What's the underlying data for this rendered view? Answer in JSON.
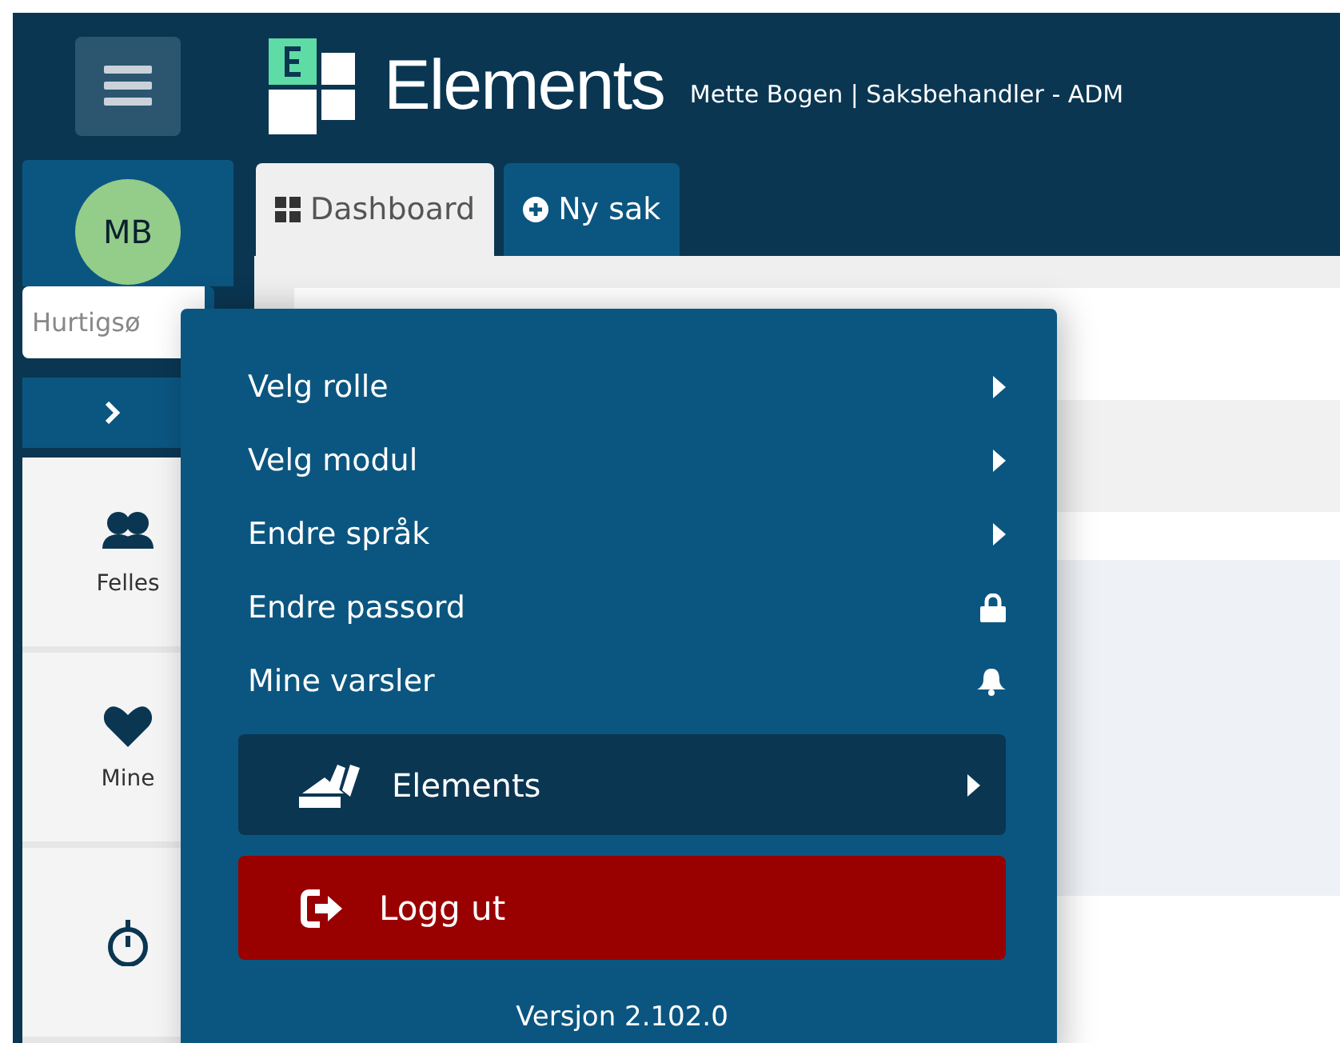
{
  "header": {
    "app_name": "Elements",
    "user": "Mette Bogen | Saksbehandler - ADM"
  },
  "sidebar": {
    "avatar": "MB",
    "search": {
      "placeholder": "Hurtigsø"
    },
    "nav": [
      {
        "label": "Felles",
        "kind": "people"
      },
      {
        "label": "Mine",
        "kind": "heart"
      },
      {
        "kind": "stopwatch"
      }
    ]
  },
  "tabs": [
    {
      "label": "Dashboard",
      "selected": true
    },
    {
      "label": "Ny sak",
      "selected": false
    }
  ],
  "user_menu": {
    "items": [
      {
        "label": "Velg rolle",
        "kind": "submenu"
      },
      {
        "label": "Velg modul",
        "kind": "submenu"
      },
      {
        "label": "Endre språk",
        "kind": "submenu"
      },
      {
        "label": "Endre passord",
        "kind": "lock"
      },
      {
        "label": "Mine varsler",
        "kind": "bell"
      }
    ],
    "module": {
      "label": "Elements"
    },
    "logout": {
      "label": "Logg ut"
    },
    "version": "Versjon 2.102.0"
  }
}
